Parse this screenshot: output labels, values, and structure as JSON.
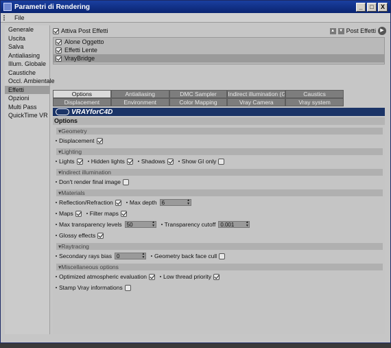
{
  "window": {
    "title": "Parametri di Rendering",
    "buttons": [
      "_",
      "□",
      "X"
    ]
  },
  "menu": {
    "file": "File"
  },
  "sidebar": {
    "items": [
      {
        "label": "Generale"
      },
      {
        "label": "Uscita"
      },
      {
        "label": "Salva"
      },
      {
        "label": "Antialiasing"
      },
      {
        "label": "Illum. Globale"
      },
      {
        "label": "Caustiche"
      },
      {
        "label": "Occl. Ambientale"
      },
      {
        "label": "Effetti",
        "active": true
      },
      {
        "label": "Opzioni"
      },
      {
        "label": "Multi Pass"
      },
      {
        "label": "QuickTime VR"
      }
    ]
  },
  "post": {
    "activate_label": "Attiva Post Effetti",
    "activate_checked": true,
    "menu_label": "Post Effetti"
  },
  "effects": [
    {
      "label": "Alone Oggetto",
      "checked": true
    },
    {
      "label": "Effetti Lente",
      "checked": true
    },
    {
      "label": "VrayBridge",
      "checked": true,
      "selected": true
    }
  ],
  "tabs": {
    "row1": [
      "Options",
      "Antialiasing",
      "DMC Sampler",
      "Indirect illumination (GI)",
      "Caustics"
    ],
    "row2": [
      "Displacement",
      "Environment",
      "Color Mapping",
      "Vray Camera",
      "Vray system"
    ],
    "active": "Options"
  },
  "banner": {
    "text": "VRAYforC4D"
  },
  "options": {
    "title": "Options",
    "geometry": {
      "header": "Geometry",
      "displacement": "Displacement"
    },
    "lighting": {
      "header": "Lighting",
      "lights": "Lights",
      "hidden_lights": "Hidden lights",
      "shadows": "Shadows",
      "show_gi_only": "Show GI only"
    },
    "indirect": {
      "header": "Indirect illumination",
      "dont_render": "Don't render final image"
    },
    "materials": {
      "header": "Materials",
      "reflection": "Reflection/Refraction",
      "max_depth_label": "Max depth",
      "max_depth_value": "6",
      "maps": "Maps",
      "filter_maps": "Filter maps",
      "max_transp_label": "Max transparency levels",
      "max_transp_value": "50",
      "transp_cutoff_label": "Transparency cutoff",
      "transp_cutoff_value": "0.001",
      "glossy": "Glossy effects"
    },
    "raytracing": {
      "header": "Raytracing",
      "secondary_bias_label": "Secondary rays bias",
      "secondary_bias_value": "0",
      "backface": "Geometry back face cull"
    },
    "misc": {
      "header": "Miscellaneous options",
      "optimized": "Optimized atmospheric evaluation",
      "low_priority": "Low thread priority",
      "stamp": "Stamp Vray informations"
    }
  },
  "checks": {
    "displacement": true,
    "lights": true,
    "hidden_lights": true,
    "shadows": true,
    "show_gi_only": false,
    "dont_render": false,
    "reflection": true,
    "maps": true,
    "filter_maps": true,
    "glossy": true,
    "backface": false,
    "optimized": true,
    "low_priority": true,
    "stamp": false
  }
}
